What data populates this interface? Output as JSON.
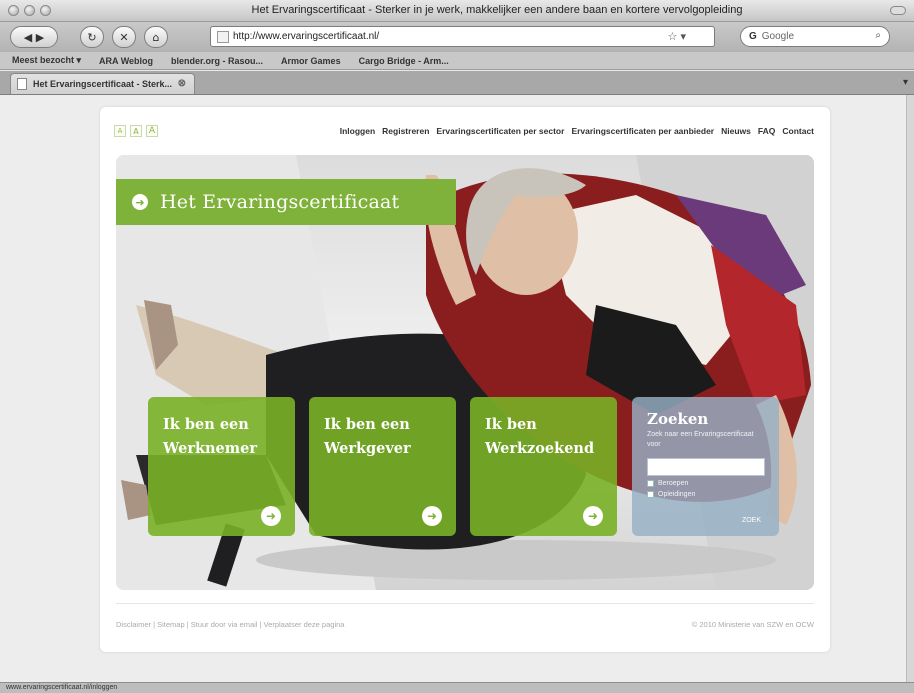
{
  "window": {
    "title": "Het Ervaringscertificaat - Sterker in je werk, makkelijker een andere baan en kortere vervolgopleiding"
  },
  "toolbar": {
    "url": "http://www.ervaringscertificaat.nl/",
    "search_placeholder": "Google",
    "search_engine_icon": "G"
  },
  "bookmarks": [
    "Meest bezocht ▾",
    "ARA Weblog",
    "blender.org - Rasou...",
    "Armor Games",
    "Cargo Bridge - Arm..."
  ],
  "tab": {
    "label": "Het Ervaringscertificaat - Sterk..."
  },
  "site": {
    "font_size_buttons": [
      "A",
      "A",
      "A"
    ],
    "nav": [
      "Inloggen",
      "Registreren",
      "Ervaringscertificaten per sector",
      "Ervaringscertificaten per aanbieder",
      "Nieuws",
      "FAQ",
      "Contact"
    ],
    "hero_title": "Het Ervaringscertificaat",
    "tiles": [
      {
        "line1": "Ik ben een",
        "line2": "Werknemer"
      },
      {
        "line1": "Ik ben een",
        "line2": "Werkgever"
      },
      {
        "line1": "Ik ben",
        "line2": "Werkzoekend"
      }
    ],
    "search": {
      "heading": "Zoeken",
      "hint": "Zoek naar een Ervaringscertificaat voor",
      "option1": "Beroepen",
      "option2": "Opleidingen",
      "submit": "ZOEK"
    },
    "footer_left": "Disclaimer | Sitemap | Stuur door via email | Verplaatser deze pagina",
    "footer_right": "© 2010 Ministerie van SZW en OCW"
  },
  "status": {
    "text": "www.ervaringscertificaat.nl/inloggen"
  },
  "colors": {
    "brand_green": "#7fb23a",
    "search_tile": "#96b0c4"
  }
}
